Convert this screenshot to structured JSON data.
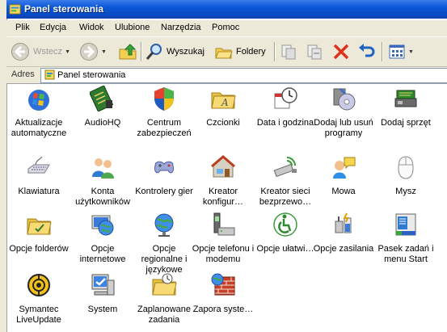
{
  "window": {
    "title": "Panel sterowania"
  },
  "menu": [
    "Plik",
    "Edycja",
    "Widok",
    "Ulubione",
    "Narzędzia",
    "Pomoc"
  ],
  "toolbar": {
    "back_label": "Wstecz",
    "search_label": "Wyszukaj",
    "folders_label": "Foldery"
  },
  "address": {
    "label": "Adres",
    "value": "Panel sterowania"
  },
  "items": [
    {
      "name": "Aktualizacje automatyczne",
      "icon": "windows-update-icon"
    },
    {
      "name": "AudioHQ",
      "icon": "circuit-board-icon"
    },
    {
      "name": "Centrum zabezpieczeń",
      "icon": "security-shield-icon"
    },
    {
      "name": "Czcionki",
      "icon": "fonts-folder-icon"
    },
    {
      "name": "Data i godzina",
      "icon": "clock-calendar-icon"
    },
    {
      "name": "Dodaj lub usuń programy",
      "icon": "add-remove-programs-icon"
    },
    {
      "name": "Dodaj sprzęt",
      "icon": "add-hardware-icon"
    },
    {
      "name": "Klawiatura",
      "icon": "keyboard-icon"
    },
    {
      "name": "Konta użytkowników",
      "icon": "user-accounts-icon"
    },
    {
      "name": "Kontrolery gier",
      "icon": "gamepad-icon"
    },
    {
      "name": "Kreator konfigur…",
      "icon": "network-house-icon"
    },
    {
      "name": "Kreator sieci bezprzewo…",
      "icon": "wireless-adapter-icon"
    },
    {
      "name": "Mowa",
      "icon": "speech-icon"
    },
    {
      "name": "Mysz",
      "icon": "mouse-icon"
    },
    {
      "name": "Opcje folderów",
      "icon": "folder-options-icon"
    },
    {
      "name": "Opcje internetowe",
      "icon": "internet-globe-icon"
    },
    {
      "name": "Opcje regionalne i językowe",
      "icon": "regional-globe-icon"
    },
    {
      "name": "Opcje telefonu i modemu",
      "icon": "phone-modem-icon"
    },
    {
      "name": "Opcje ułatwi…",
      "icon": "accessibility-icon"
    },
    {
      "name": "Opcje zasilania",
      "icon": "power-icon"
    },
    {
      "name": "Pasek zadań i menu Start",
      "icon": "taskbar-icon"
    },
    {
      "name": "Symantec LiveUpdate",
      "icon": "liveupdate-icon"
    },
    {
      "name": "System",
      "icon": "system-monitor-icon"
    },
    {
      "name": "Zaplanowane zadania",
      "icon": "scheduled-tasks-icon"
    },
    {
      "name": "Zapora syste…",
      "icon": "firewall-icon"
    }
  ],
  "colors": {
    "titlebar": "#0a58d6",
    "chrome": "#ece9d8",
    "content": "#ffffff"
  }
}
